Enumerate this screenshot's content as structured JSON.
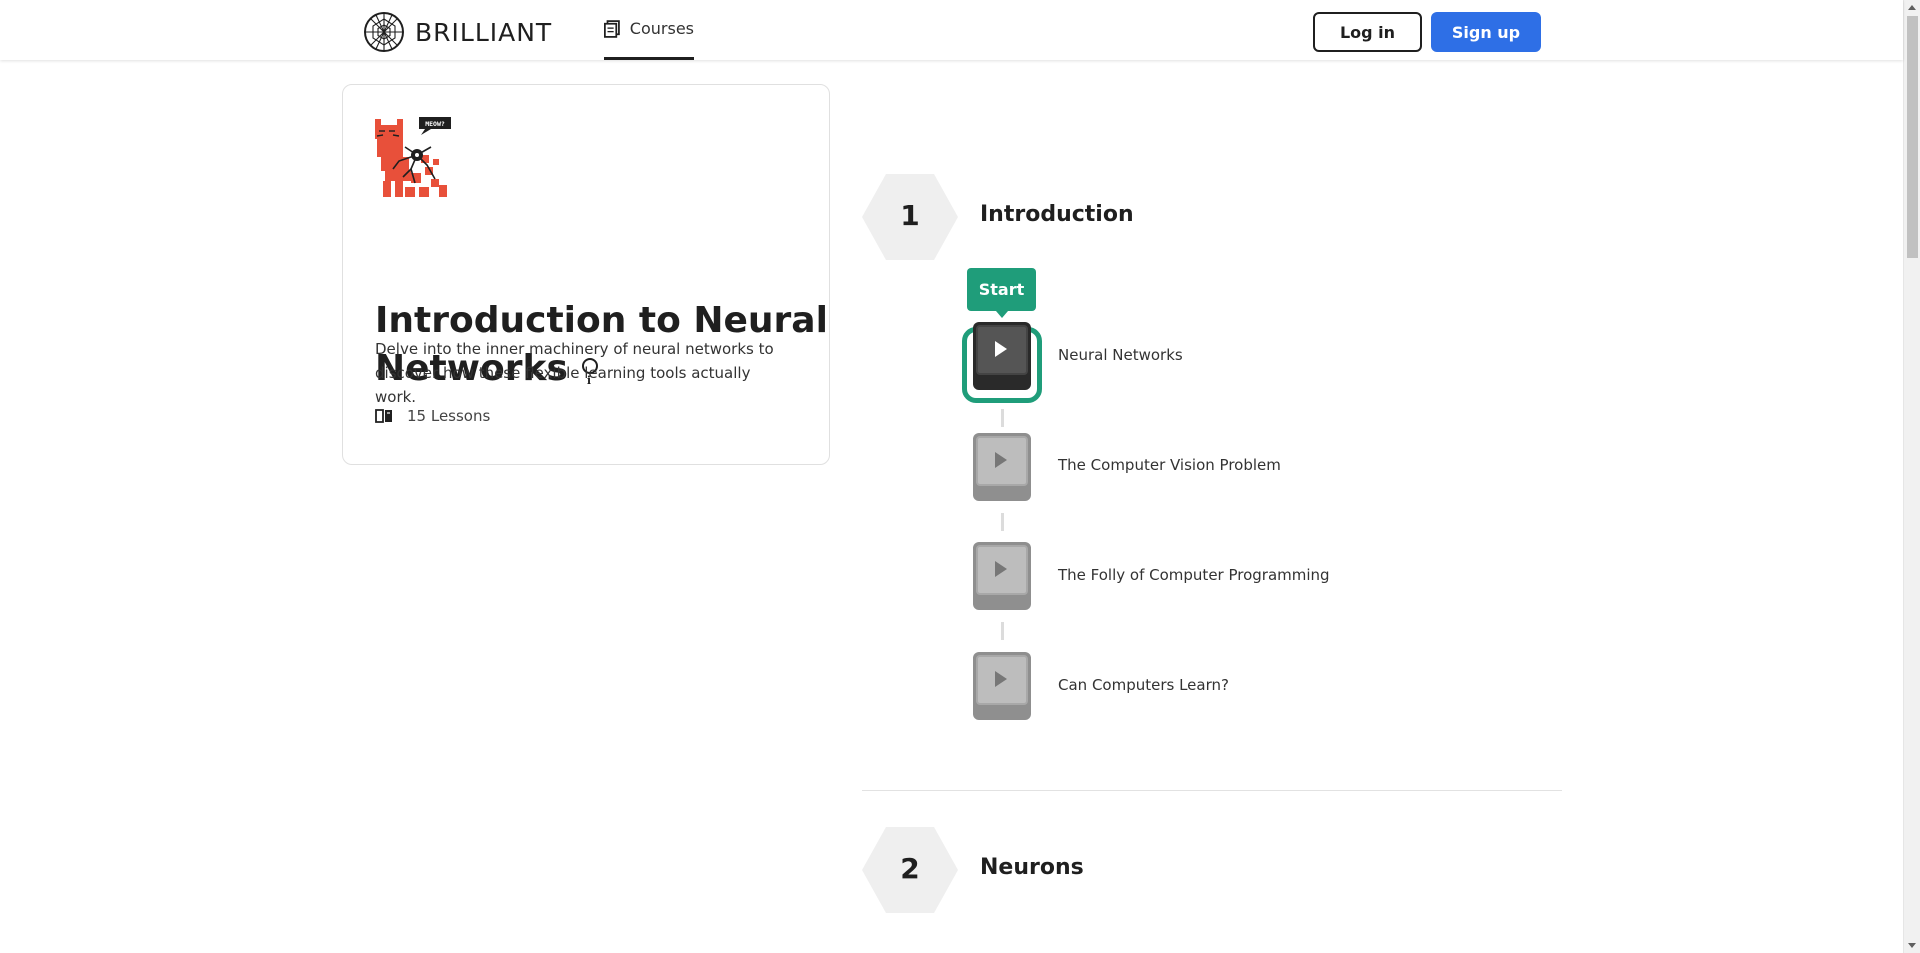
{
  "header": {
    "brand": "BRILLIANT",
    "nav_courses": "Courses",
    "login": "Log in",
    "signup": "Sign up"
  },
  "course": {
    "image_badge": "MEOW?",
    "title_line1": "Introduction to Neural",
    "title_line2": "Networks",
    "description": "Delve into the inner machinery of neural networks to discover how these flexible learning tools actually work.",
    "lessons_count": "15 Lessons"
  },
  "chapters": [
    {
      "number": "1",
      "title": "Introduction",
      "start_label": "Start",
      "lessons": [
        {
          "title": "Neural Networks",
          "active": true
        },
        {
          "title": "The Computer Vision Problem",
          "active": false
        },
        {
          "title": "The Folly of Computer Programming",
          "active": false
        },
        {
          "title": "Can Computers Learn?",
          "active": false
        }
      ]
    },
    {
      "number": "2",
      "title": "Neurons",
      "lessons": []
    }
  ],
  "colors": {
    "accent_green": "#1f9d7a",
    "signup_blue": "#2e6fe6",
    "course_art_red": "#e8503a"
  },
  "icons": {
    "logo": "brilliant-logo-icon",
    "courses": "book-icon",
    "info": "info-icon",
    "lessons": "open-book-icon",
    "lesson_play": "play-icon"
  }
}
